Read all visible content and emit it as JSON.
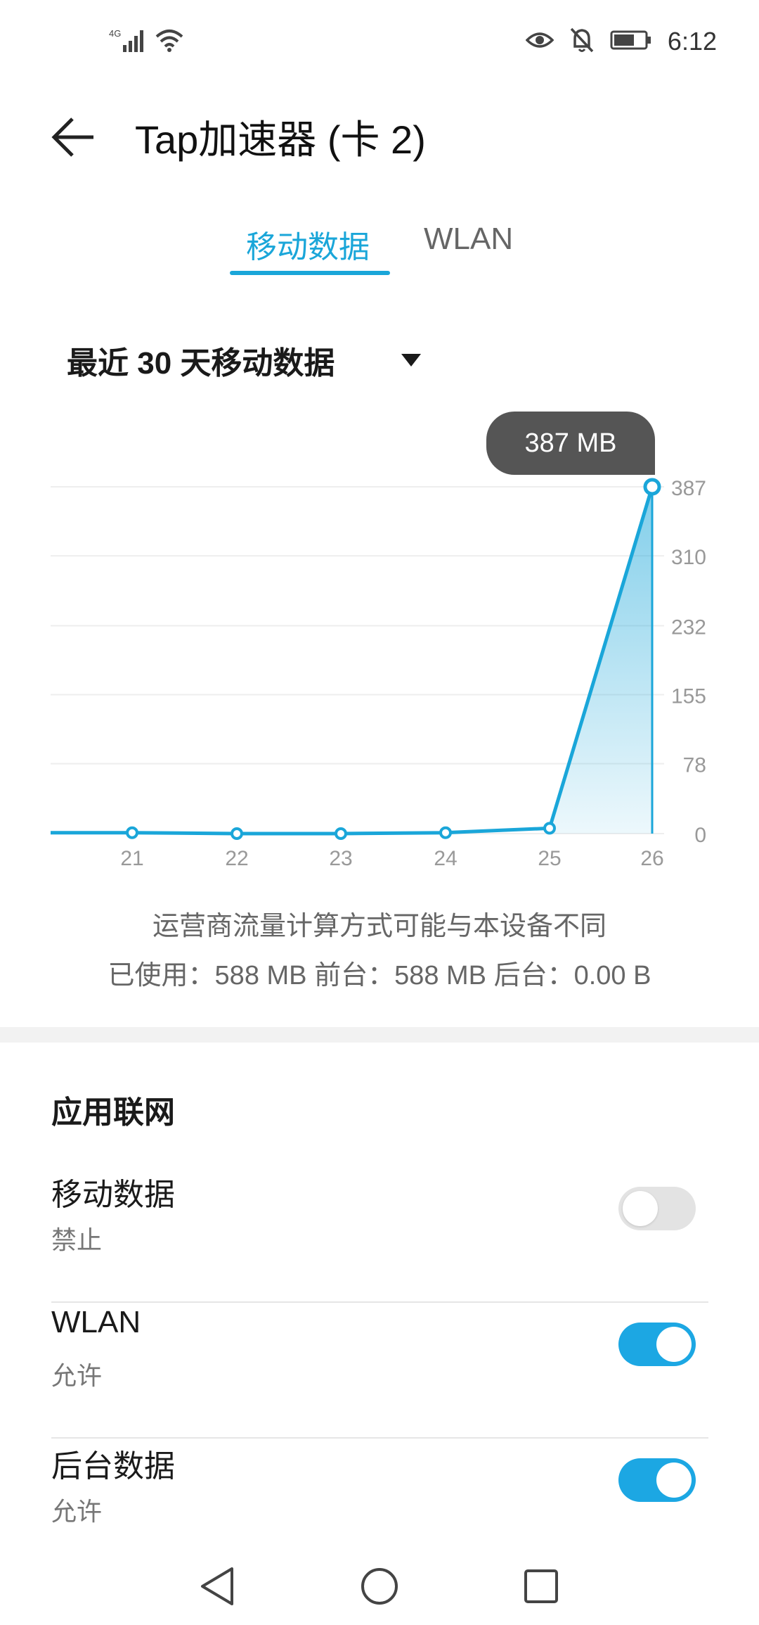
{
  "status_bar": {
    "network": "4G",
    "time": "6:12",
    "icons": [
      "signal-icon",
      "wifi-icon",
      "eye-icon",
      "bell-off-icon",
      "battery-icon"
    ]
  },
  "header": {
    "title": "Tap加速器 (卡 2)",
    "back_icon": "back-arrow-icon"
  },
  "tabs": [
    {
      "label": "移动数据",
      "active": true
    },
    {
      "label": "WLAN",
      "active": false
    }
  ],
  "period_selector": {
    "label": "最近 30 天移动数据"
  },
  "tooltip": "387 MB",
  "chart_data": {
    "type": "area",
    "categories": [
      "21",
      "22",
      "23",
      "24",
      "25",
      "26"
    ],
    "values": [
      1,
      0,
      0,
      1,
      6,
      387
    ],
    "y_ticks": [
      "387",
      "310",
      "232",
      "155",
      "78",
      "0"
    ],
    "ylim": [
      0,
      387
    ],
    "grid": true,
    "color": "#1aa6d9"
  },
  "info": {
    "carrier_note": "运营商流量计算方式可能与本设备不同",
    "usage": "已使用：588 MB 前台：588 MB 后台：0.00 B"
  },
  "settings": {
    "section_title": "应用联网",
    "rows": [
      {
        "title": "移动数据",
        "subtitle": "禁止",
        "enabled": false
      },
      {
        "title": "WLAN",
        "subtitle": "允许",
        "enabled": true
      },
      {
        "title": "后台数据",
        "subtitle": "允许",
        "enabled": true
      }
    ]
  },
  "colors": {
    "accent": "#1aa6d9",
    "toggle_on": "#1ca7e3",
    "toggle_off": "#e3e3e3"
  }
}
